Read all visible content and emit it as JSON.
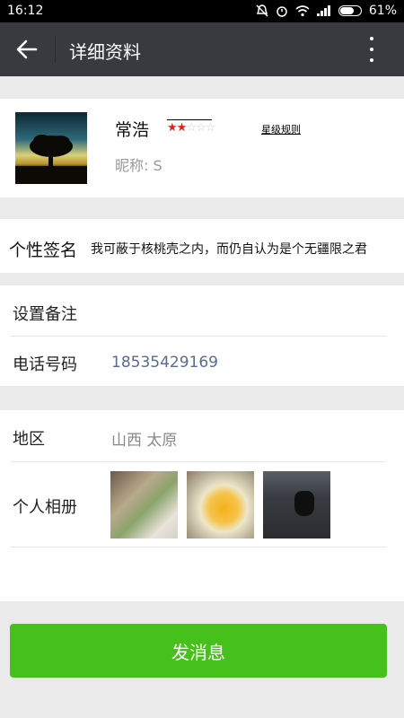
{
  "status_bar": {
    "time": "16:12",
    "battery": "61%",
    "icons": [
      "mute-icon",
      "alarm-icon",
      "wifi-icon",
      "signal-icon",
      "battery-icon"
    ]
  },
  "app_bar": {
    "title": "详细资料",
    "back_icon": "back-arrow-icon",
    "more_icon": "more-vertical-icon"
  },
  "profile": {
    "name": "常浩",
    "stars_filled": 2,
    "stars_total": 5,
    "star_rule_link": "星级规则",
    "nickname": "昵称: S",
    "colors": {
      "star_on": "#e41f1f",
      "star_off": "#cccccc"
    }
  },
  "signature": {
    "label": "个性签名",
    "text": "我可蔽于核桃壳之内，而仍自认为是个无疆限之君"
  },
  "fields": {
    "remark_label": "设置备注",
    "phone_label": "电话号码",
    "phone_value": "18535429169",
    "region_label": "地区",
    "region_value": "山西  太原",
    "album_label": "个人相册"
  },
  "actions": {
    "send_message": "发消息",
    "accent_color": "#46c01b"
  }
}
